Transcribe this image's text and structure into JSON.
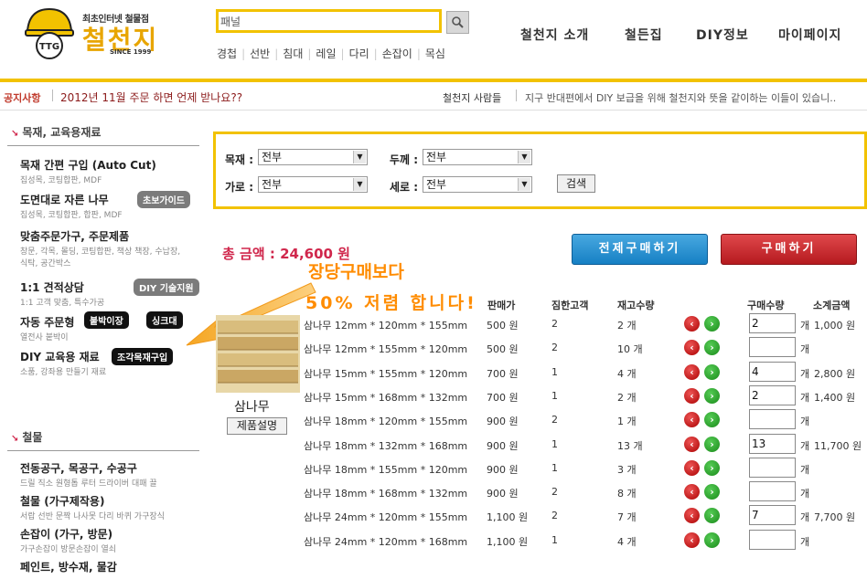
{
  "header": {
    "logo_sub": "최초인터넷 철물점",
    "logo_main": "철천지",
    "logo_since": "SINCE 1999",
    "search_placeholder": "패널",
    "categories": [
      "경첩",
      "선반",
      "침대",
      "레일",
      "다리",
      "손잡이",
      "목심"
    ],
    "nav": [
      "철천지 소개",
      "철든집",
      "DIY정보",
      "마이페이지"
    ]
  },
  "notice": {
    "label": "공지사항",
    "text": "2012년 11월 주문 하면 언제 받나요??",
    "people_label": "철천지 사람들",
    "people_text": "지구 반대편에서 DIY 보급을 위해 철천지와 뜻을 같이하는 이들이 있습니.."
  },
  "sidebar": {
    "section1": "목재, 교육용재료",
    "items": [
      {
        "title": "목재 간편 구입 (Auto Cut)",
        "desc": "집성목, 코팅합판, MDF"
      },
      {
        "title": "도면대로 자른 나무",
        "desc": "집성목, 코팅합판, 합판, MDF",
        "badge": "초보가이드"
      },
      {
        "title": "맞춤주문가구, 주문제품",
        "desc": "창문, 각목, 몰딩, 코팅합판, 책상 책장, 수납장, 식탁, 공간박스"
      },
      {
        "title": "1:1 견적상담",
        "desc": "1:1 고객 맞춤, 특수가공",
        "badge": "DIY 기술지원"
      },
      {
        "title": "자동 주문형",
        "desc": "열전사 붙박이",
        "badges": [
          "붙박이장",
          "싱크대"
        ]
      },
      {
        "title": "DIY 교육용 재료",
        "desc": "소품, 강좌용 만들기 재료",
        "badges": [
          "조각목재구입"
        ]
      }
    ],
    "section2": "철물",
    "items2": [
      {
        "title": "전동공구, 목공구, 수공구",
        "desc": "드릴 직소 원형톱 루터 드라이버 대패 끌"
      },
      {
        "title": "철물 (가구제작용)",
        "desc": "서랍 선반 문짝 나사못 다리 바퀴 가구장식"
      },
      {
        "title": "손잡이 (가구, 방문)",
        "desc": "가구손잡이 방문손잡이 열쇠"
      },
      {
        "title": "페인트, 방수재, 물감",
        "desc": ""
      }
    ]
  },
  "filter": {
    "labels": [
      "목재 :",
      "두께 :",
      "가로 :",
      "세로 :"
    ],
    "values": [
      "전부",
      "전부",
      "전부",
      "전부"
    ],
    "search_label": "검색"
  },
  "order": {
    "total_label": "총 금액 : 24,600 원",
    "buy_all_label": "전제구매하기",
    "buy_label": "구매하기",
    "promo1": "장당구매보다",
    "promo2": "50% 저렴 합니다!",
    "headers": {
      "price": "판매가",
      "min": "짐한고객",
      "stock": "재고수량",
      "qty": "구매수량",
      "subtotal": "소계금액"
    },
    "product_name": "삼나무",
    "product_desc_button": "제품설명",
    "rows": [
      {
        "name": "삼나무 12mm * 120mm * 155mm",
        "price": "500 원",
        "min": "2",
        "stock": "2 개",
        "qty": "2",
        "unit": "개",
        "subtotal": "1,000 원"
      },
      {
        "name": "삼나무 12mm * 155mm * 120mm",
        "price": "500 원",
        "min": "2",
        "stock": "10 개",
        "qty": "",
        "unit": "개",
        "subtotal": ""
      },
      {
        "name": "삼나무 15mm * 155mm * 120mm",
        "price": "700 원",
        "min": "1",
        "stock": "4 개",
        "qty": "4",
        "unit": "개",
        "subtotal": "2,800 원"
      },
      {
        "name": "삼나무 15mm * 168mm * 132mm",
        "price": "700 원",
        "min": "1",
        "stock": "2 개",
        "qty": "2",
        "unit": "개",
        "subtotal": "1,400 원"
      },
      {
        "name": "삼나무 18mm * 120mm * 155mm",
        "price": "900 원",
        "min": "2",
        "stock": "1 개",
        "qty": "",
        "unit": "개",
        "subtotal": ""
      },
      {
        "name": "삼나무 18mm * 132mm * 168mm",
        "price": "900 원",
        "min": "1",
        "stock": "13 개",
        "qty": "13",
        "unit": "개",
        "subtotal": "11,700 원"
      },
      {
        "name": "삼나무 18mm * 155mm * 120mm",
        "price": "900 원",
        "min": "1",
        "stock": "3 개",
        "qty": "",
        "unit": "개",
        "subtotal": ""
      },
      {
        "name": "삼나무 18mm * 168mm * 132mm",
        "price": "900 원",
        "min": "2",
        "stock": "8 개",
        "qty": "",
        "unit": "개",
        "subtotal": ""
      },
      {
        "name": "삼나무 24mm * 120mm * 155mm",
        "price": "1,100 원",
        "min": "2",
        "stock": "7 개",
        "qty": "7",
        "unit": "개",
        "subtotal": "7,700 원"
      },
      {
        "name": "삼나무 24mm * 120mm * 168mm",
        "price": "1,100 원",
        "min": "1",
        "stock": "4 개",
        "qty": "",
        "unit": "개",
        "subtotal": ""
      }
    ]
  },
  "colors": {
    "accent": "#f2c200",
    "total": "#d0274c",
    "promo": "#ff8c00",
    "buy_all": "#1680c4",
    "buy": "#b51a1f"
  }
}
